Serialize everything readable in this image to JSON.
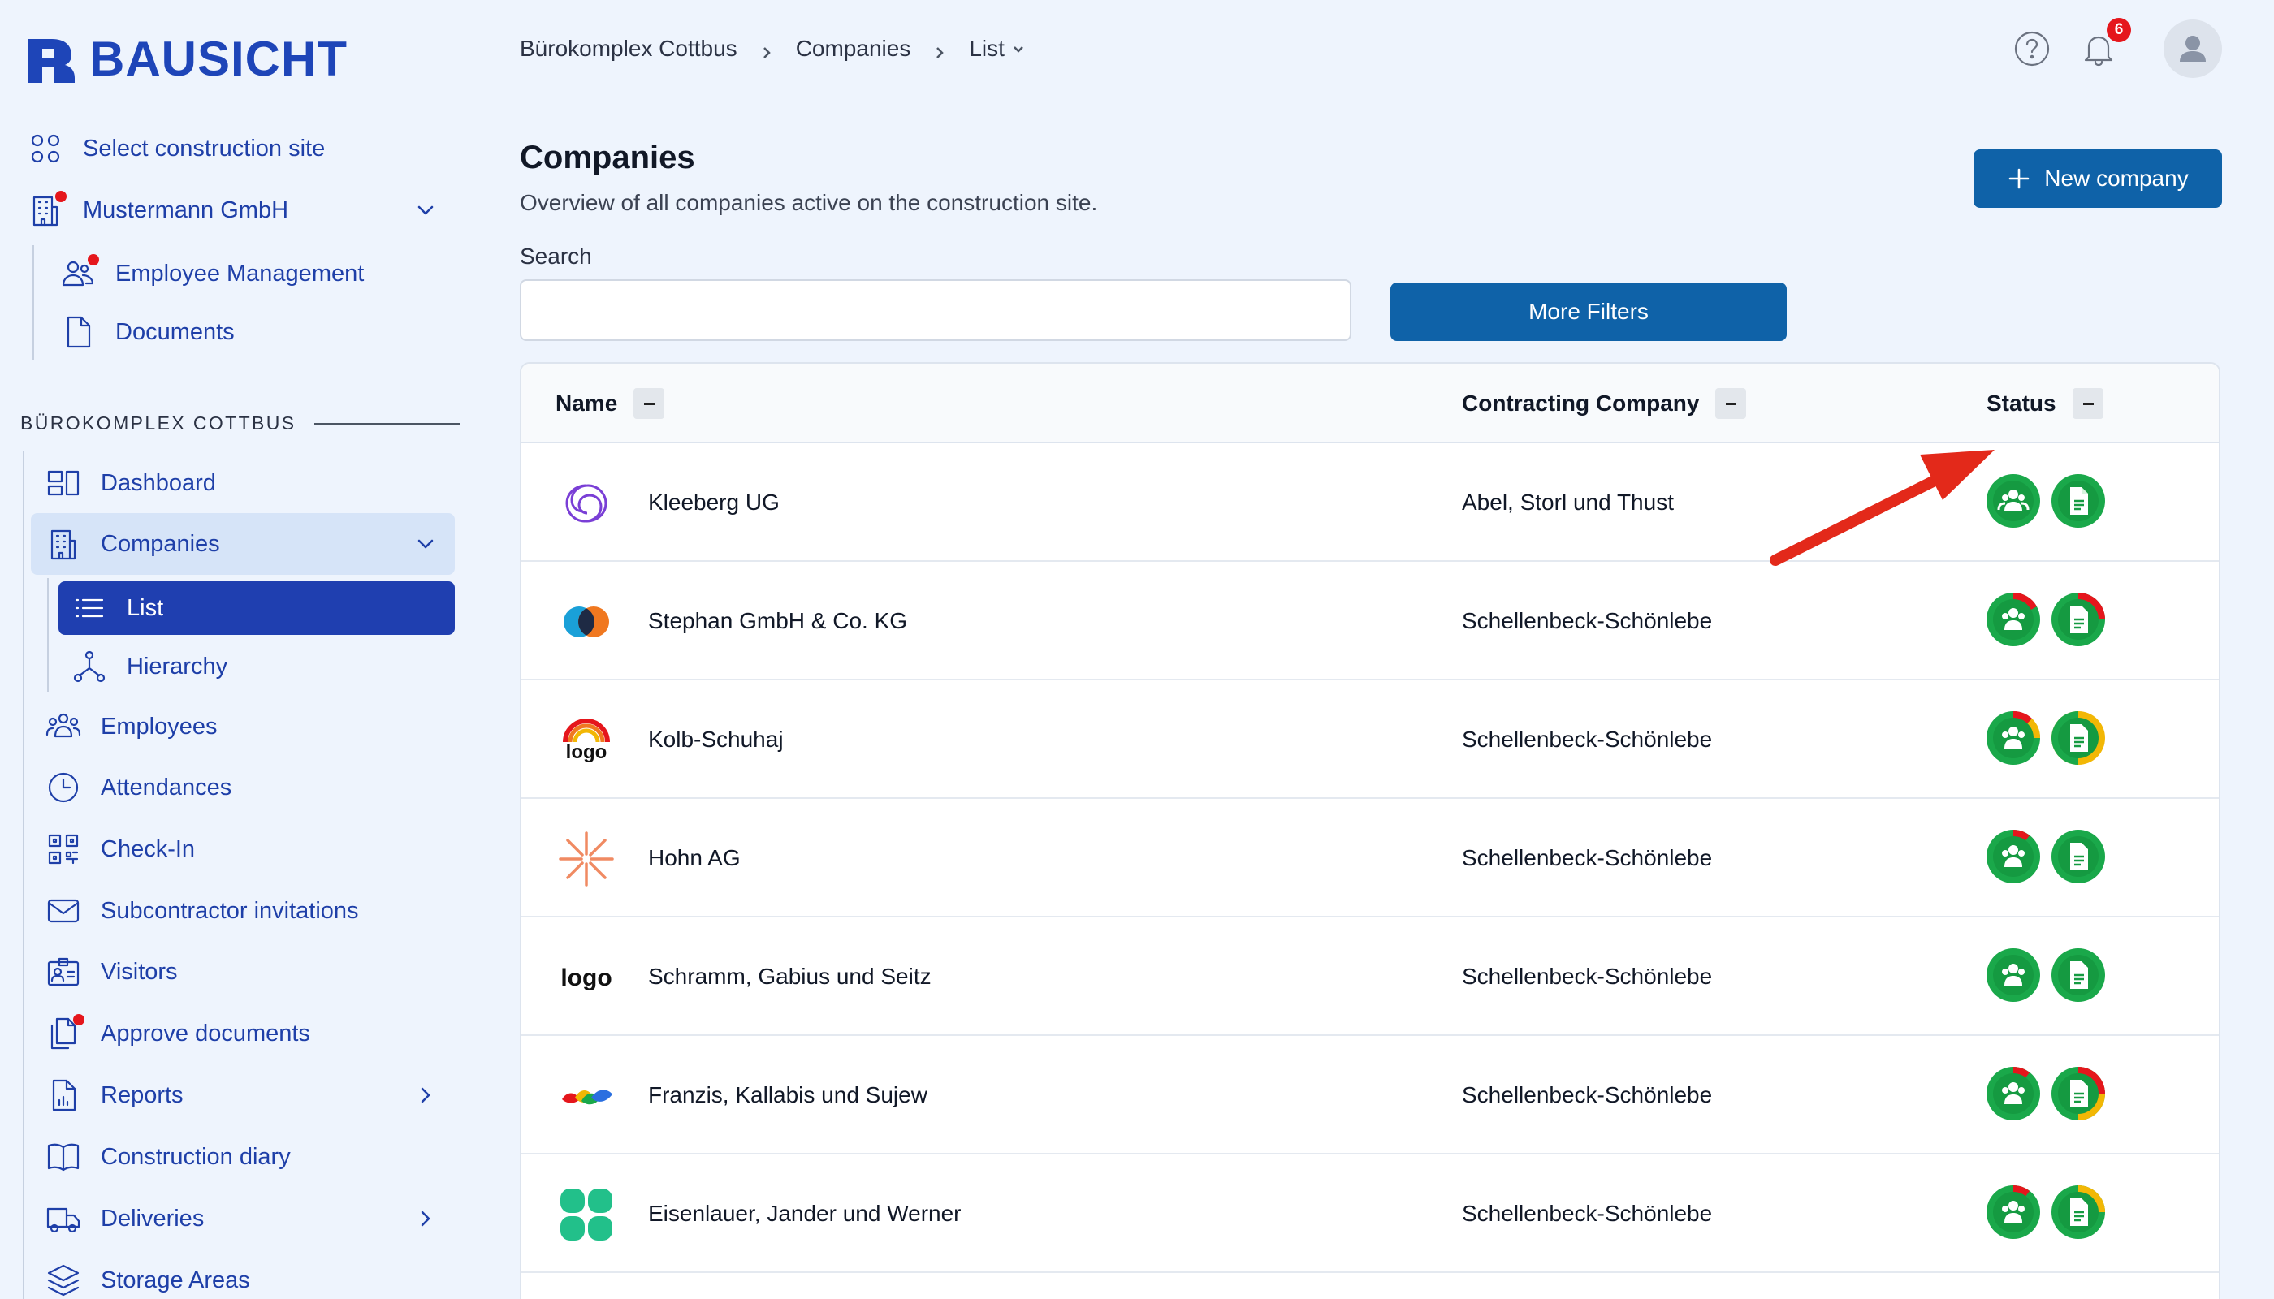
{
  "app": {
    "brand": "BAUSICHT"
  },
  "sidebar": {
    "select_site": "Select construction site",
    "company": "Mustermann GmbH",
    "company_sub": [
      "Employee Management",
      "Documents"
    ],
    "section_title": "BÜROKOMPLEX COTTBUS",
    "items": [
      {
        "label": "Dashboard",
        "icon": "dashboard-icon"
      },
      {
        "label": "Companies",
        "icon": "building-icon"
      },
      {
        "label": "List",
        "icon": "list-icon"
      },
      {
        "label": "Hierarchy",
        "icon": "hierarchy-icon"
      },
      {
        "label": "Employees",
        "icon": "people-icon"
      },
      {
        "label": "Attendances",
        "icon": "clock-icon"
      },
      {
        "label": "Check-In",
        "icon": "qr-code-icon"
      },
      {
        "label": "Subcontractor invitations",
        "icon": "envelope-icon"
      },
      {
        "label": "Visitors",
        "icon": "id-card-icon"
      },
      {
        "label": "Approve documents",
        "icon": "documents-icon"
      },
      {
        "label": "Reports",
        "icon": "report-icon"
      },
      {
        "label": "Construction diary",
        "icon": "book-icon"
      },
      {
        "label": "Deliveries",
        "icon": "truck-icon"
      },
      {
        "label": "Storage Areas",
        "icon": "layers-icon"
      }
    ]
  },
  "header": {
    "breadcrumb": [
      "Bürokomplex Cottbus",
      "Companies",
      "List"
    ],
    "notification_count": "6"
  },
  "page": {
    "title": "Companies",
    "subtitle": "Overview of all companies active on the construction site.",
    "new_button": "New company",
    "search_label": "Search",
    "search_value": "",
    "filters_button": "More Filters"
  },
  "table": {
    "columns": [
      "Name",
      "Contracting Company",
      "Status"
    ],
    "rows": [
      {
        "name": "Kleeberg UG",
        "contractor": "Abel, Storl und Thust",
        "logo": "swirl-logo",
        "employees": "complete",
        "documents": "complete"
      },
      {
        "name": "Stephan GmbH & Co. KG",
        "contractor": "Schellenbeck-Schönlebe",
        "logo": "circles-logo",
        "employees": "partial-red",
        "documents": "partial-red"
      },
      {
        "name": "Kolb-Schuhaj",
        "contractor": "Schellenbeck-Schönlebe",
        "logo": "logo-rainbow",
        "employees": "mixed",
        "documents": "mostly-yellow"
      },
      {
        "name": "Hohn AG",
        "contractor": "Schellenbeck-Schönlebe",
        "logo": "sunburst-logo",
        "employees": "partial-red",
        "documents": "complete"
      },
      {
        "name": "Schramm, Gabius und Seitz",
        "contractor": "Schellenbeck-Schönlebe",
        "logo": "logo-text",
        "employees": "complete",
        "documents": "complete"
      },
      {
        "name": "Franzis, Kallabis und Sujew",
        "contractor": "Schellenbeck-Schönlebe",
        "logo": "petals-logo",
        "employees": "partial-red",
        "documents": "red-yellow"
      },
      {
        "name": "Eisenlauer, Jander und Werner",
        "contractor": "Schellenbeck-Schönlebe",
        "logo": "clover-logo",
        "employees": "partial-red",
        "documents": "partial-yellow"
      }
    ]
  },
  "colors": {
    "primary": "#1f3fb0",
    "button": "#0f62a8",
    "ok": "#1aa84a",
    "warn": "#f2b705",
    "error": "#e5161c"
  }
}
